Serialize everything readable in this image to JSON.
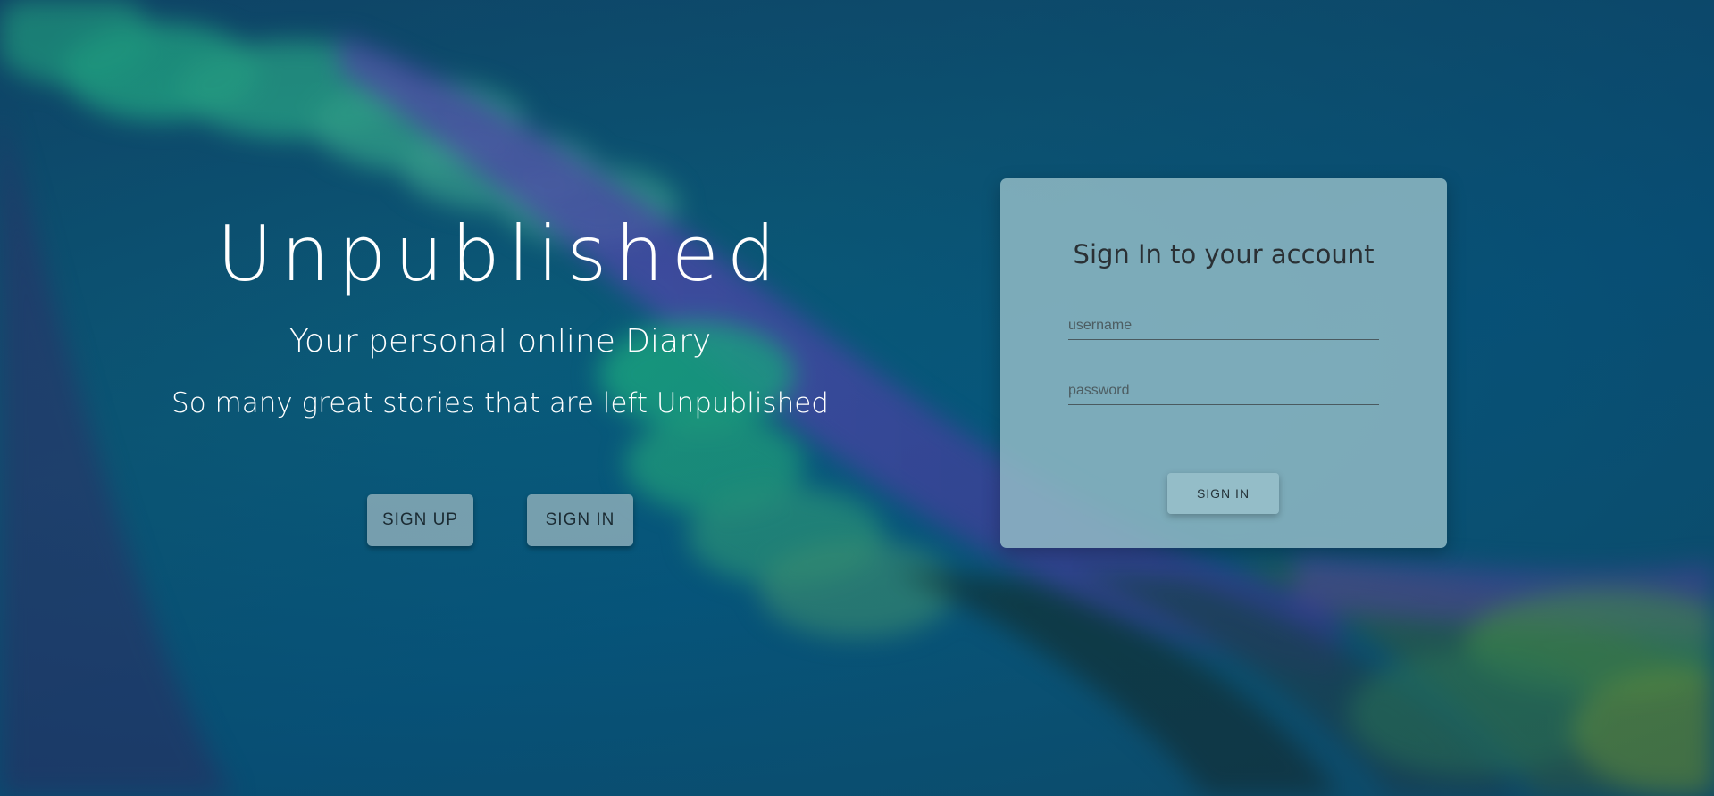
{
  "hero": {
    "title": "Unpublished",
    "subtitle": "Your personal online Diary",
    "tagline": "So many great stories that are left Unpublished",
    "signup_label": "SIGN UP",
    "signin_label": "SIGN IN"
  },
  "signin_card": {
    "title": "Sign In to your account",
    "username_placeholder": "username",
    "password_placeholder": "password",
    "submit_label": "SIGN IN"
  },
  "colors": {
    "background": "#0a5a78",
    "card": "#96bec8",
    "text_light": "#ffffff",
    "text_dark": "#2a3034"
  }
}
